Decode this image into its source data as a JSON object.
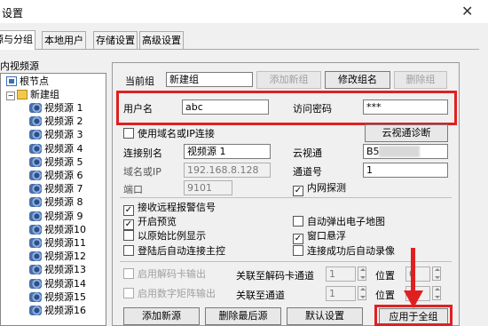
{
  "window": {
    "title": "设置"
  },
  "tabs": [
    "源与分组",
    "本地用户",
    "存储设置",
    "高级设置"
  ],
  "tree": {
    "group_label": "内视频源",
    "root": "根节点",
    "folder": "新建组",
    "sources": [
      "视频源 1",
      "视频源 2",
      "视频源 3",
      "视频源 4",
      "视频源 5",
      "视频源 6",
      "视频源 7",
      "视频源 8",
      "视频源 9",
      "视频源10",
      "视频源11",
      "视频源12",
      "视频源13",
      "视频源14",
      "视频源15",
      "视频源16"
    ]
  },
  "group": {
    "current_label": "当前组",
    "current_value": "新建组",
    "add_button": "添加新组",
    "rename_button": "修改组名",
    "delete_button": "删除组"
  },
  "auth": {
    "user_label": "用户名",
    "user_value": "abc",
    "password_label": "访问密码",
    "password_value": "***"
  },
  "source": {
    "use_domain_label": "使用域名或IP连接",
    "cloud_diag_button": "云视通诊断",
    "alias_label": "连接别名",
    "alias_value": "视频源 1",
    "cloud_label": "云视通",
    "cloud_value": "B5",
    "domain_label": "域名或IP",
    "domain_value": "192.168.8.128",
    "channel_label": "通道号",
    "channel_value": "1",
    "port_label": "端口",
    "port_value": "9101",
    "lan_probe_label": "内网探测"
  },
  "options": {
    "alarm": "接收远程报警信号",
    "preview": "开启预览",
    "popup_map": "自动弹出电子地图",
    "original_ratio": "以原始比例显示",
    "float_window": "窗口悬浮",
    "auto_stream": "登陆后自动连接主控",
    "auto_record": "连接成功后自动录像"
  },
  "output": {
    "decoder_label": "启用解码卡输出",
    "decoder_assoc": "关联至解码卡通道",
    "decoder_channel": "1",
    "decoder_pos_label": "位置",
    "decoder_pos": "0",
    "matrix_label": "启用数字矩阵输出",
    "matrix_assoc": "关联至通道",
    "matrix_channel": "1",
    "matrix_pos_label": "位置",
    "matrix_pos": "0"
  },
  "buttons": {
    "add_source": "添加新源",
    "delete_last": "删除最后源",
    "default": "默认设置",
    "apply_all": "应用于全组"
  },
  "annotation_color": "#e02020"
}
